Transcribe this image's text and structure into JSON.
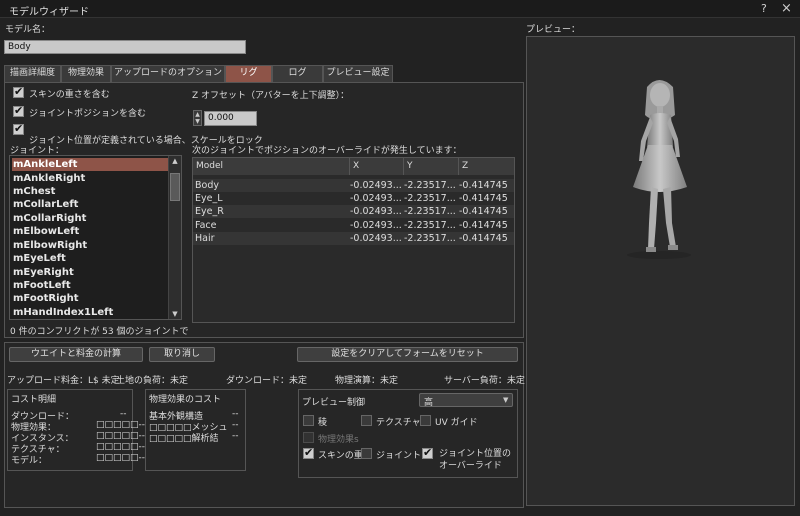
{
  "window": {
    "title": "モデルウィザード",
    "help": "?",
    "close": "×"
  },
  "model_name": {
    "label": "モデル名：",
    "value": "Body"
  },
  "tabs": [
    "描画詳細度",
    "物理効果",
    "アップロードのオプション",
    "リグ",
    "ログ",
    "プレビュー設定"
  ],
  "rig": {
    "skin_weights_label": "スキンの重さを含む",
    "joint_positions_label": "ジョイントポジションを含む",
    "lock_scale_label": "ジョイント位置が定義されている場合、スケールをロック",
    "z_offset_label": "Z オフセット（アバターを上下調整）：",
    "z_offset_value": "0.000",
    "joints_label": "ジョイント：",
    "override_label": "次のジョイントでポジションのオーバーライドが発生しています：",
    "conflict_text": "0 件のコンフリクトが 53 個のジョイントで"
  },
  "joints": [
    "mAnkleLeft",
    "mAnkleRight",
    "mChest",
    "mCollarLeft",
    "mCollarRight",
    "mElbowLeft",
    "mElbowRight",
    "mEyeLeft",
    "mEyeRight",
    "mFootLeft",
    "mFootRight",
    "mHandIndex1Left"
  ],
  "override_table": {
    "headers": [
      "Model",
      "X",
      "Y",
      "Z"
    ],
    "rows": [
      [
        "Body",
        "-0.02493...",
        "-2.23517...",
        "-0.414745"
      ],
      [
        "Eye_L",
        "-0.02493...",
        "-2.23517...",
        "-0.414745"
      ],
      [
        "Eye_R",
        "-0.02493...",
        "-2.23517...",
        "-0.414745"
      ],
      [
        "Face",
        "-0.02493...",
        "-2.23517...",
        "-0.414745"
      ],
      [
        "Hair",
        "-0.02493...",
        "-2.23517...",
        "-0.414745"
      ]
    ]
  },
  "buttons": {
    "calculate": "ウエイトと料金の計算",
    "cancel": "取り消し",
    "clear_reset": "設定をクリアしてフォームをリセット"
  },
  "status": {
    "upload_fee": "アップロード料金：L$ 未定",
    "land_impact": "土地の負荷：未定",
    "download": "ダウンロード：未定",
    "physics": "物理演算：未定",
    "server": "サーバー負荷：未定"
  },
  "cost_breakdown": {
    "title": "コスト明細",
    "rows": [
      {
        "label": "ダウンロード：",
        "value": "--"
      },
      {
        "label": "物理効果：",
        "value": "□□□□□--"
      },
      {
        "label": "インスタンス：",
        "value": "□□□□□--"
      },
      {
        "label": "テクスチャ：",
        "value": "□□□□□--"
      },
      {
        "label": "モデル：",
        "value": "□□□□□--"
      }
    ]
  },
  "physics_cost": {
    "title": "物理効果のコスト",
    "rows": [
      {
        "label": "基本外観構造",
        "value": "--"
      },
      {
        "label": "□□□□□メッシュ",
        "value": "--"
      },
      {
        "label": "□□□□□解析結",
        "value": "--"
      }
    ]
  },
  "preview_controls": {
    "title": "プレビュー制御",
    "lod": "高",
    "edges": "稜",
    "textures": "テクスチャ",
    "uv_guide": "UV ガイド",
    "physics": "物理効果s",
    "skin_weights": "スキンの重さ",
    "joints": "ジョイント",
    "joint_overrides": "ジョイント位置のオーバーライド"
  },
  "preview": {
    "label": "プレビュー："
  }
}
